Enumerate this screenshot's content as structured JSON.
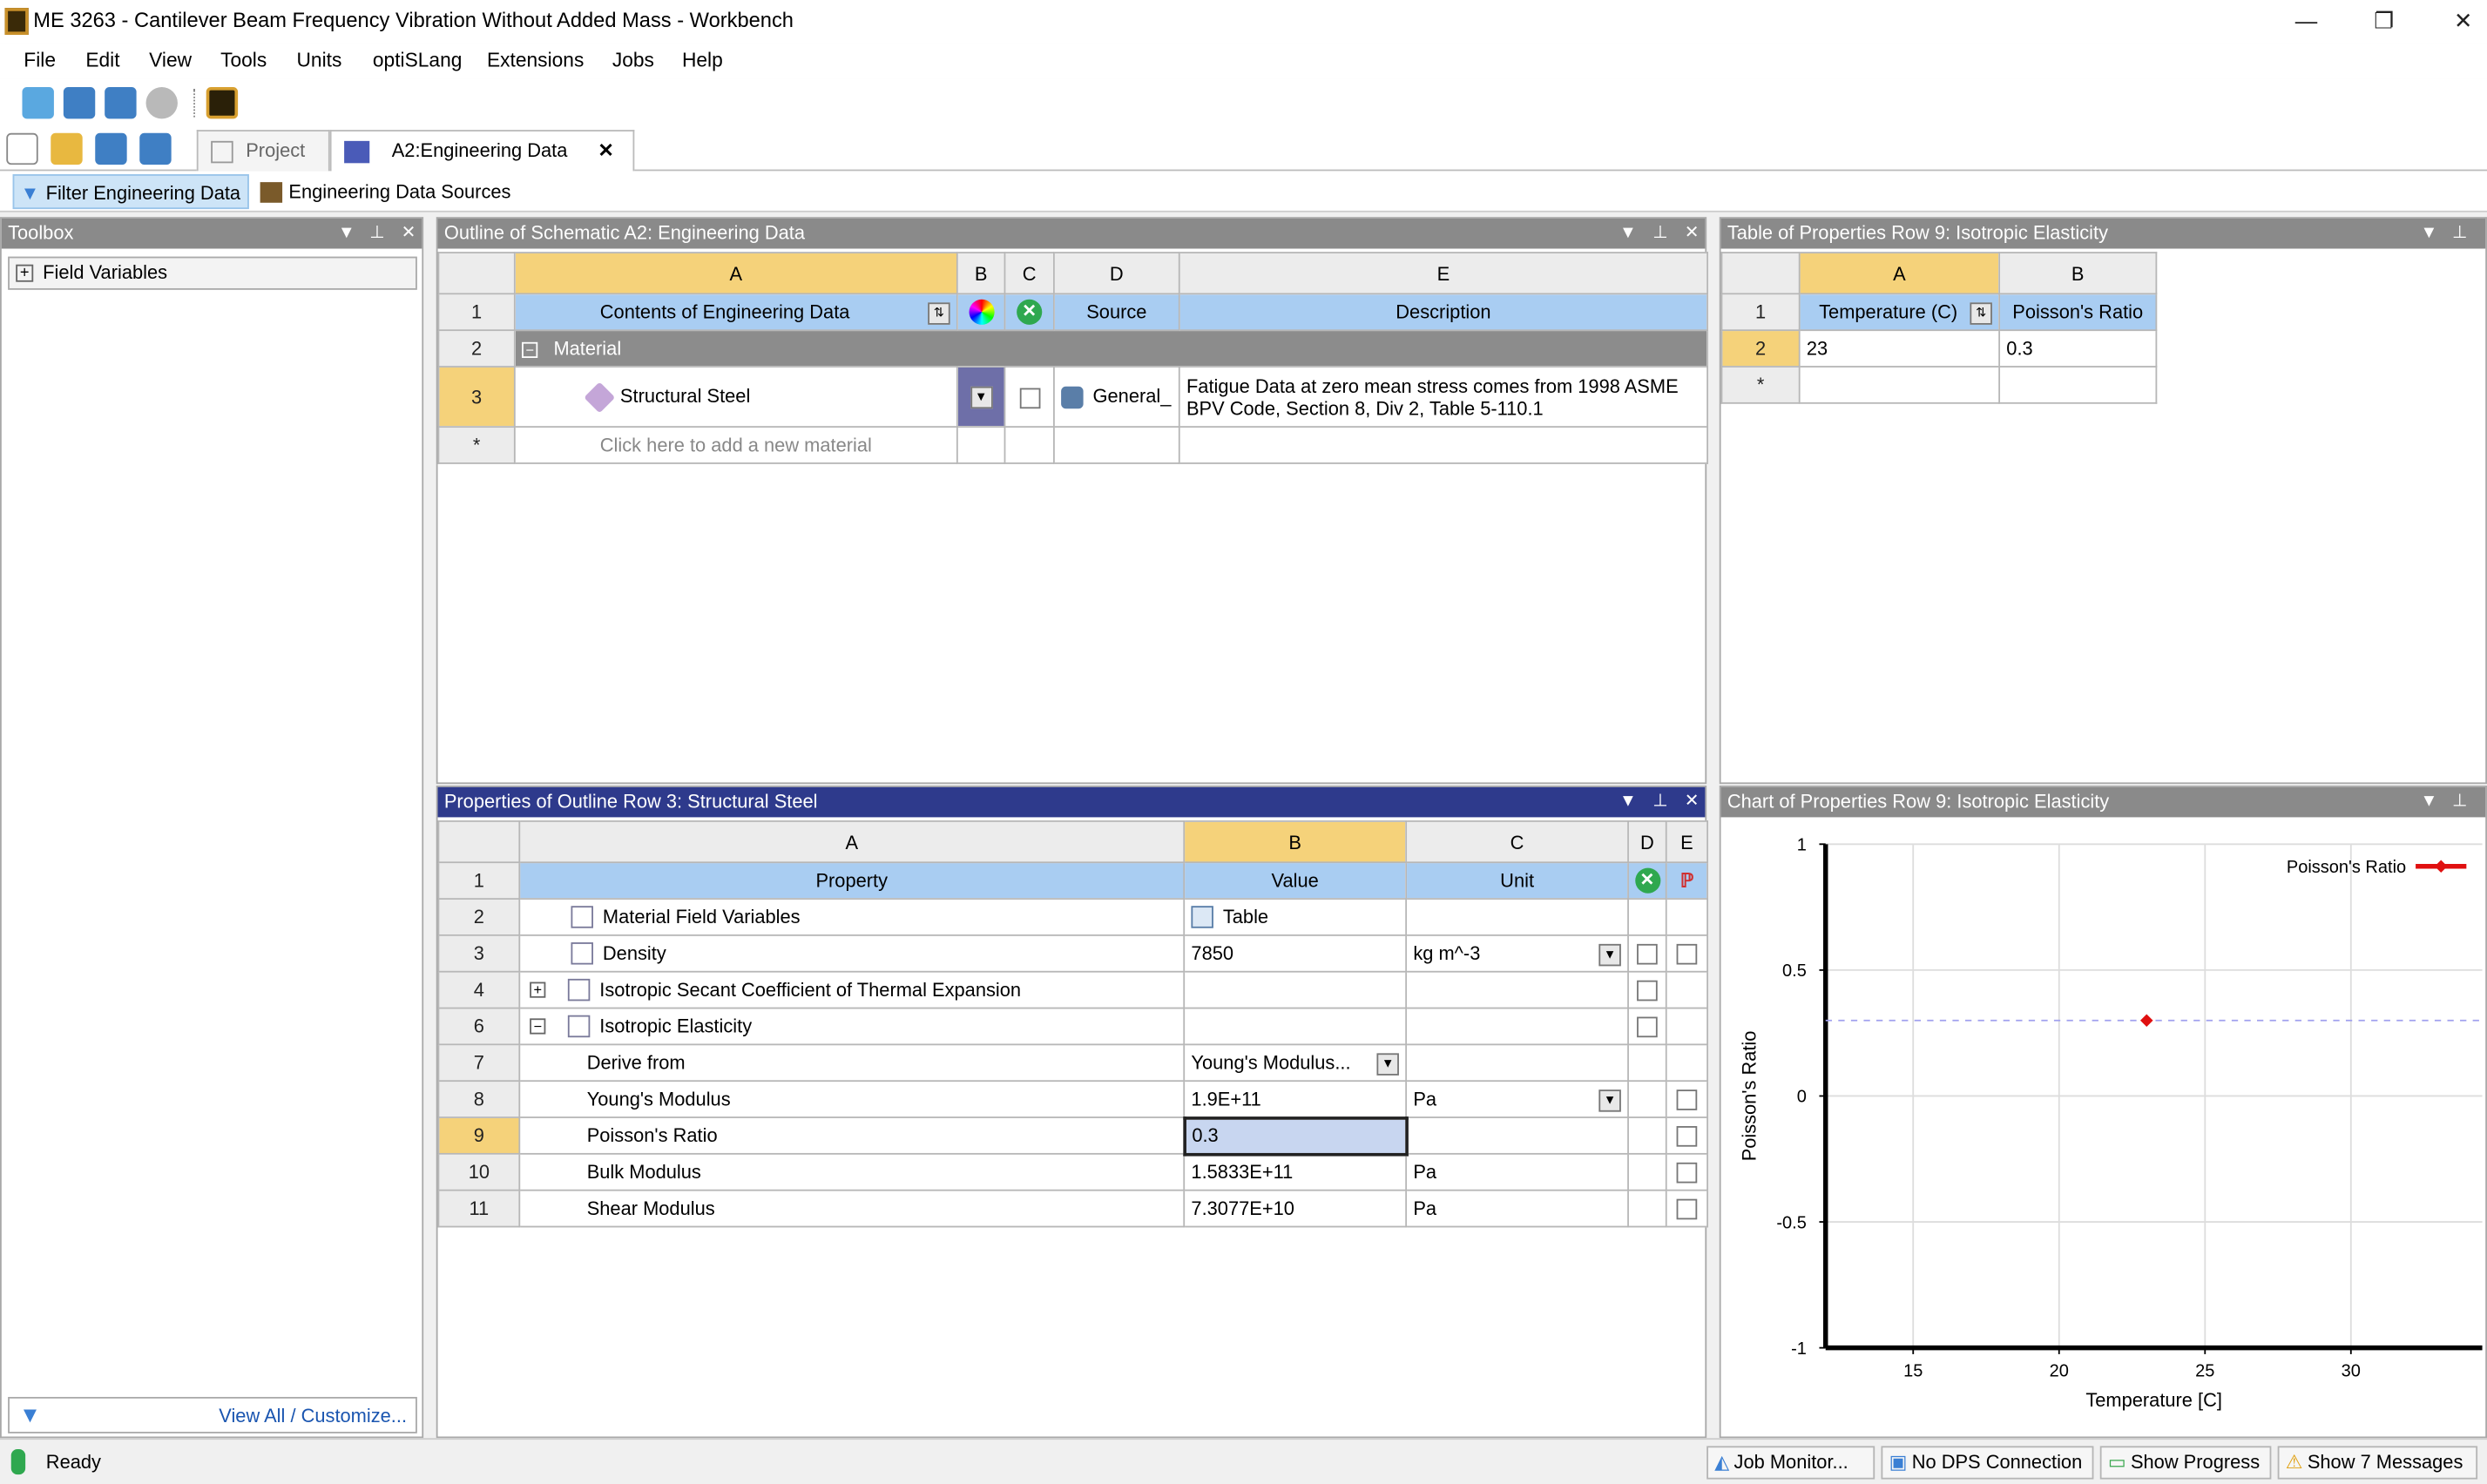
{
  "window": {
    "title": "ME 3263 - Cantilever Beam Frequency Vibration Without Added Mass - Workbench",
    "minimize": "—",
    "restore": "❐",
    "close": "✕"
  },
  "menu": [
    "File",
    "Edit",
    "View",
    "Tools",
    "Units",
    "optiSLang",
    "Extensions",
    "Jobs",
    "Help"
  ],
  "tabs": {
    "project": "Project",
    "engineering": "A2:Engineering Data",
    "close": "✕"
  },
  "toolbar2": {
    "filter": "Filter Engineering Data",
    "sources": "Engineering Data Sources"
  },
  "toolbox": {
    "title": "Toolbox",
    "item": "Field Variables",
    "footer": "View All / Customize..."
  },
  "outline": {
    "title": "Outline of Schematic A2: Engineering Data",
    "col_letters": [
      "A",
      "B",
      "C",
      "D",
      "E"
    ],
    "header": {
      "contents": "Contents of Engineering Data",
      "source": "Source",
      "description": "Description"
    },
    "group": "Material",
    "material": {
      "name": "Structural Steel",
      "source": "General_",
      "description": "Fatigue Data at zero mean stress comes from 1998 ASME BPV Code, Section 8, Div 2, Table 5-110.1"
    },
    "add_hint": "Click here to add a new material",
    "row_nums": [
      "1",
      "2",
      "3",
      "*"
    ]
  },
  "props_table": {
    "title": "Table of Properties Row 9: Isotropic Elasticity",
    "col_letters": [
      "A",
      "B"
    ],
    "headers": [
      "Temperature (C)",
      "Poisson's Ratio"
    ],
    "row": [
      "23",
      "0.3"
    ],
    "row_nums": [
      "1",
      "2",
      "*"
    ]
  },
  "properties": {
    "title": "Properties of Outline Row 3: Structural Steel",
    "col_letters": [
      "A",
      "B",
      "C",
      "D",
      "E"
    ],
    "headers": [
      "Property",
      "Value",
      "Unit"
    ],
    "rows": [
      {
        "num": "2",
        "property": "Material Field Variables",
        "value": "Table",
        "unit": ""
      },
      {
        "num": "3",
        "property": "Density",
        "value": "7850",
        "unit": "kg m^-3"
      },
      {
        "num": "4",
        "property": "Isotropic Secant Coefficient of Thermal Expansion",
        "value": "",
        "unit": ""
      },
      {
        "num": "6",
        "property": "Isotropic Elasticity",
        "value": "",
        "unit": ""
      },
      {
        "num": "7",
        "property": "Derive from",
        "value": "Young's Modulus...",
        "unit": ""
      },
      {
        "num": "8",
        "property": "Young's Modulus",
        "value": "1.9E+11",
        "unit": "Pa"
      },
      {
        "num": "9",
        "property": "Poisson's Ratio",
        "value": "0.3",
        "unit": ""
      },
      {
        "num": "10",
        "property": "Bulk Modulus",
        "value": "1.5833E+11",
        "unit": "Pa"
      },
      {
        "num": "11",
        "property": "Shear Modulus",
        "value": "7.3077E+10",
        "unit": "Pa"
      }
    ]
  },
  "chart_panel": {
    "title": "Chart of Properties Row 9: Isotropic Elasticity"
  },
  "chart_data": {
    "type": "scatter",
    "xlabel": "Temperature  [C]",
    "ylabel": "Poisson's Ratio",
    "xlim": [
      12,
      34.5
    ],
    "ylim": [
      -1,
      1
    ],
    "xticks": [
      15,
      20,
      25,
      30
    ],
    "yticks": [
      1,
      0.5,
      0,
      -0.5,
      -1
    ],
    "ytick_labels": [
      "1",
      "0.5",
      "0",
      "-0.5",
      "-1"
    ],
    "series": [
      {
        "name": "Poisson's Ratio",
        "x": [
          23
        ],
        "y": [
          0.3
        ],
        "color": "#e01010"
      }
    ],
    "grid": true,
    "legend": "top-right"
  },
  "status": {
    "ready": "Ready",
    "job_monitor": "Job Monitor...",
    "dps": "No DPS Connection",
    "progress": "Show Progress",
    "messages": "Show 7 Messages"
  }
}
